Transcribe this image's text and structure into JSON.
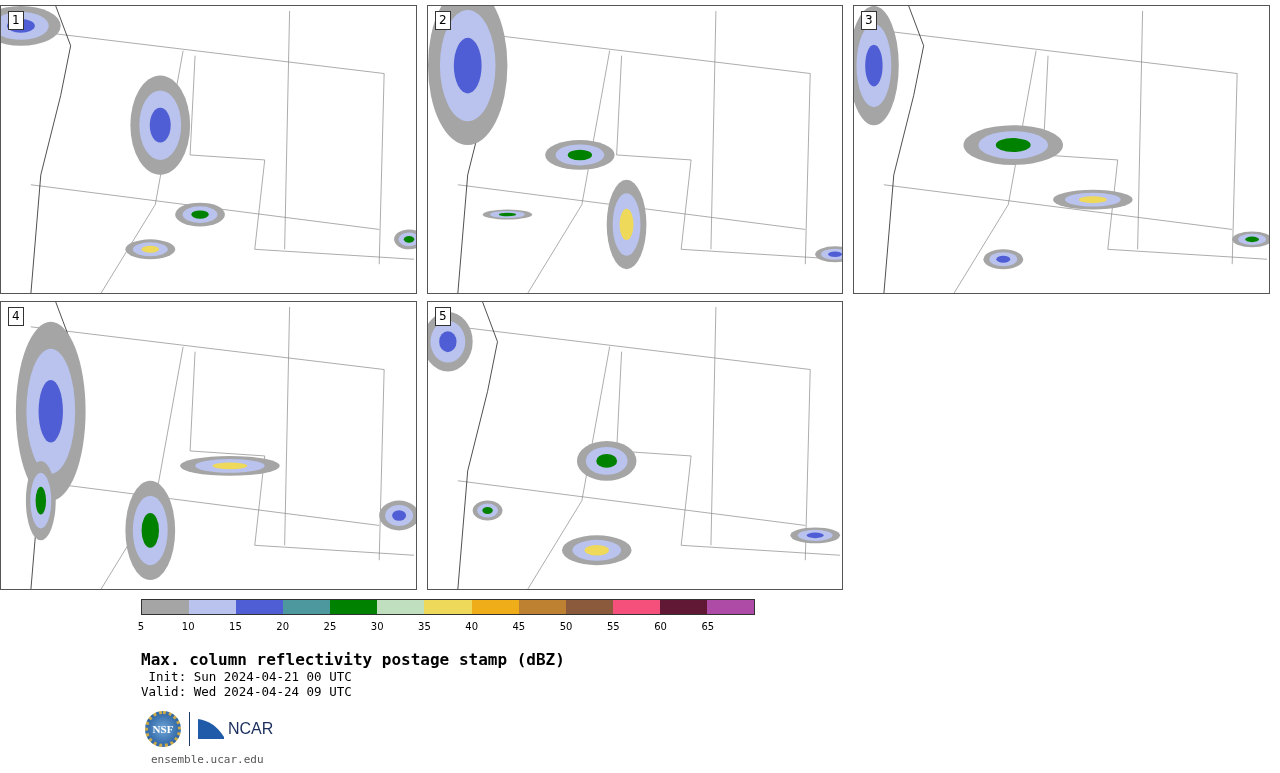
{
  "panels": [
    {
      "label": "1"
    },
    {
      "label": "2"
    },
    {
      "label": "3"
    },
    {
      "label": "4"
    },
    {
      "label": "5"
    }
  ],
  "colorbar": {
    "segments": [
      {
        "label": "5",
        "color": "#a5a5a5"
      },
      {
        "label": "10",
        "color": "#b9c3ed"
      },
      {
        "label": "15",
        "color": "#505ed6"
      },
      {
        "label": "20",
        "color": "#4d979e"
      },
      {
        "label": "25",
        "color": "#008200"
      },
      {
        "label": "30",
        "color": "#bfdfbe"
      },
      {
        "label": "35",
        "color": "#efd95a"
      },
      {
        "label": "40",
        "color": "#efad19"
      },
      {
        "label": "45",
        "color": "#bd8131"
      },
      {
        "label": "50",
        "color": "#8b5a3c"
      },
      {
        "label": "55",
        "color": "#f54f7b"
      },
      {
        "label": "60",
        "color": "#611834"
      },
      {
        "label": "65",
        "color": "#ad4ba6"
      }
    ]
  },
  "title": "Max. column reflectivity postage stamp (dBZ)",
  "init": " Init: Sun 2024-04-21 00 UTC",
  "valid": "Valid: Wed 2024-04-24 09 UTC",
  "logos": {
    "nsf": "NSF",
    "ncar": "NCAR"
  },
  "url": "ensemble.ucar.edu"
}
